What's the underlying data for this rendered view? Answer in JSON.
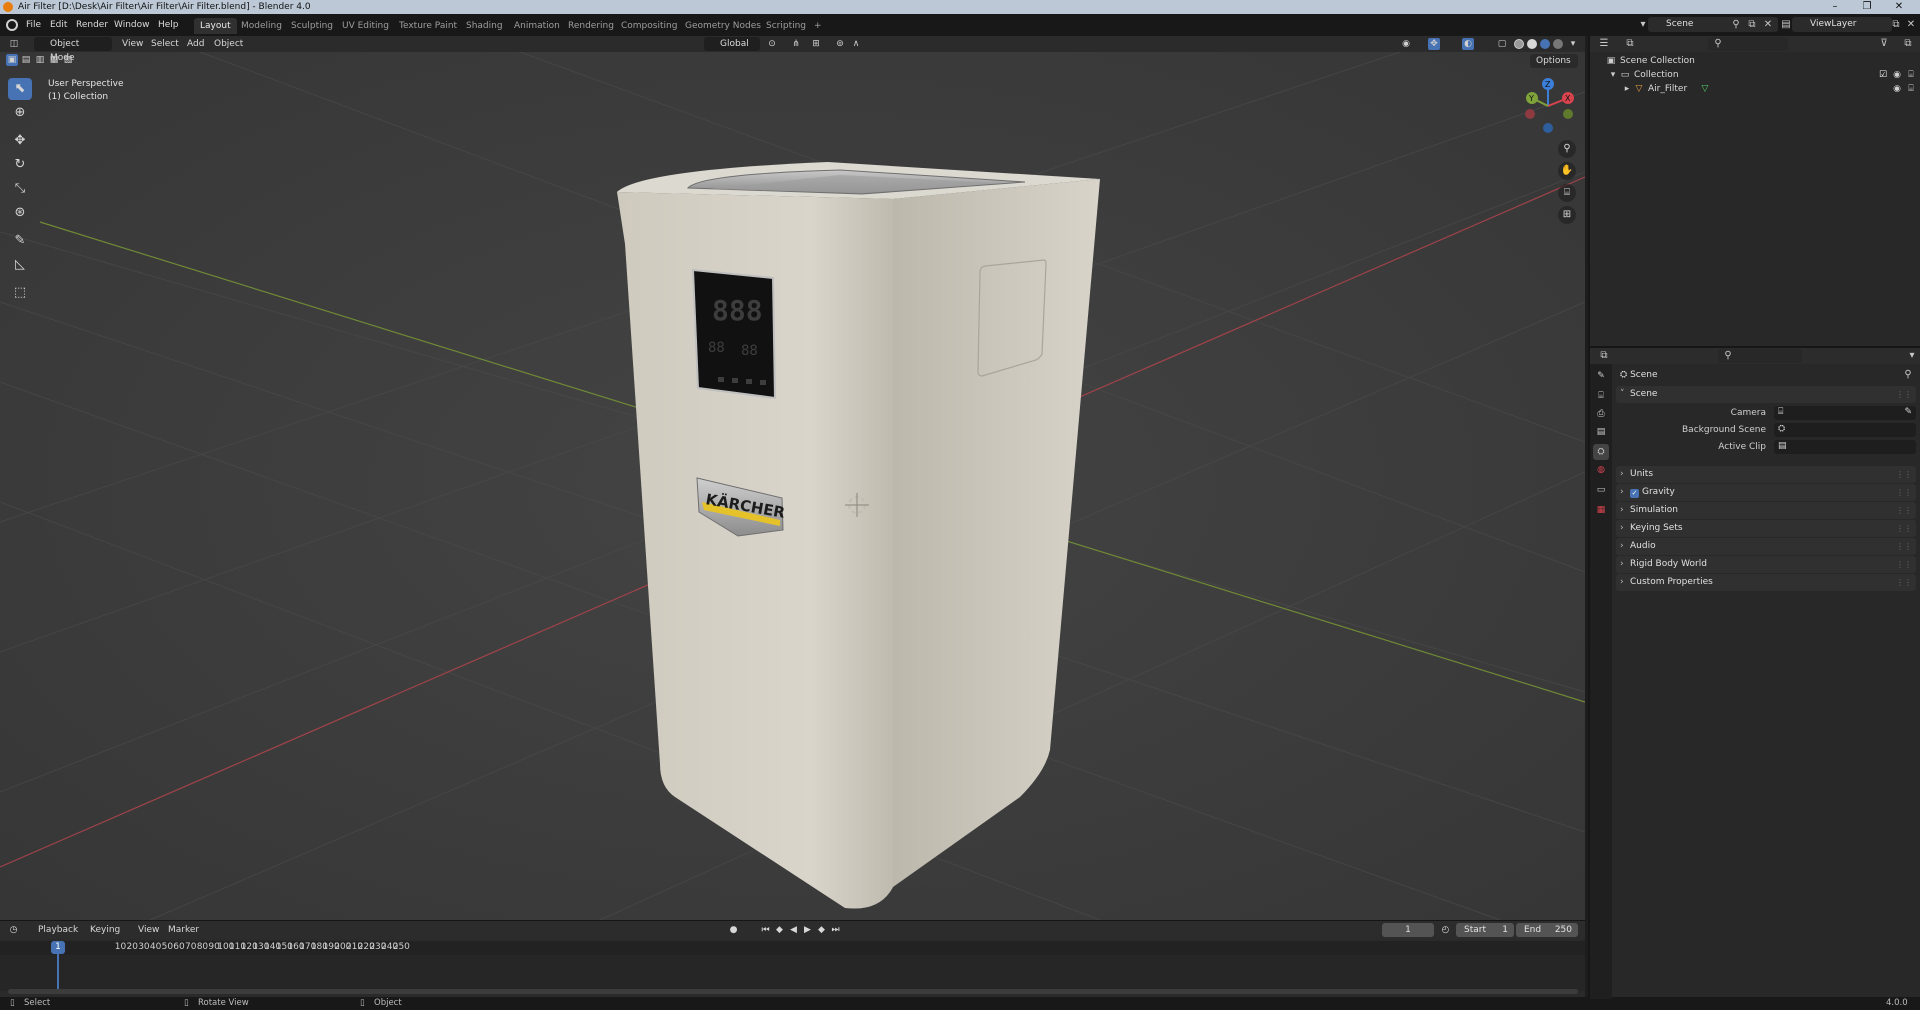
{
  "window": {
    "title": "Air Filter [D:\\Desk\\Air Filter\\Air Filter\\Air Filter.blend] - Blender 4.0",
    "controls": [
      "–",
      "❐",
      "✕"
    ]
  },
  "menubar": {
    "menus": [
      "File",
      "Edit",
      "Render",
      "Window",
      "Help"
    ],
    "workspaces": [
      "Layout",
      "Modeling",
      "Sculpting",
      "UV Editing",
      "Texture Paint",
      "Shading",
      "Animation",
      "Rendering",
      "Compositing",
      "Geometry Nodes",
      "Scripting"
    ],
    "active_workspace": "Layout",
    "add_workspace": "+",
    "scene_label": "Scene",
    "viewlayer_label": "ViewLayer"
  },
  "viewport": {
    "mode": "Object Mode",
    "menus": [
      "View",
      "Select",
      "Add",
      "Object"
    ],
    "transform_orientation": "Global",
    "options_label": "Options",
    "overlay_text_line1": "User Perspective",
    "overlay_text_line2": "(1) Collection",
    "gizmo_axes": [
      "X",
      "Y",
      "Z"
    ],
    "object_brand_text": "KÄRCHER",
    "display_digits": "888",
    "display_small_left": "88",
    "display_small_right": "88"
  },
  "timeline": {
    "menus": [
      "Playback",
      "Keying",
      "View",
      "Marker"
    ],
    "current_frame": "1",
    "start_label": "Start",
    "start_value": "1",
    "end_label": "End",
    "end_value": "250",
    "ticks": [
      "10",
      "20",
      "30",
      "40",
      "50",
      "60",
      "70",
      "80",
      "90",
      "100",
      "110",
      "120",
      "130",
      "140",
      "150",
      "160",
      "170",
      "180",
      "190",
      "200",
      "210",
      "220",
      "230",
      "240",
      "250"
    ],
    "playhead_label": "1"
  },
  "statusbar": {
    "select": "Select",
    "rotate": "Rotate View",
    "object": "Object",
    "version": "4.0.0"
  },
  "outliner": {
    "items": [
      {
        "label": "Scene Collection",
        "icon": "scene-collection-icon"
      },
      {
        "label": "Collection",
        "icon": "collection-icon"
      },
      {
        "label": "Air_Filter",
        "icon": "mesh-object-icon"
      }
    ]
  },
  "properties": {
    "breadcrumb": "Scene",
    "panels": {
      "scene": "Scene",
      "camera_label": "Camera",
      "background_label": "Background Scene",
      "clip_label": "Active Clip",
      "collapsed": [
        "Units",
        "Gravity",
        "Simulation",
        "Keying Sets",
        "Audio",
        "Rigid Body World",
        "Custom Properties"
      ]
    }
  },
  "colors": {
    "accent": "#4772b3",
    "x_axis": "#d9434e",
    "y_axis": "#7ea33a",
    "z_axis": "#3b7fd9",
    "object_body": "#d3cfc4"
  }
}
